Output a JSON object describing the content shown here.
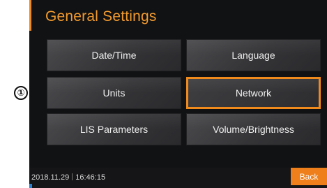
{
  "callout": {
    "label": "①"
  },
  "header": {
    "title": "General Settings"
  },
  "menu": {
    "items": [
      {
        "id": "date-time",
        "label": "Date/Time"
      },
      {
        "id": "language",
        "label": "Language"
      },
      {
        "id": "units",
        "label": "Units"
      },
      {
        "id": "network",
        "label": "Network",
        "selected": true
      },
      {
        "id": "lis-parameters",
        "label": "LIS Parameters"
      },
      {
        "id": "volume-brightness",
        "label": "Volume/Brightness"
      }
    ]
  },
  "status": {
    "date": "2018.11.29",
    "time": "16:46:15"
  },
  "footer": {
    "back_label": "Back"
  },
  "colors": {
    "accent": "#f08a1c",
    "title": "#f29a2e",
    "background": "#111214",
    "button": "#3a3a3d"
  }
}
